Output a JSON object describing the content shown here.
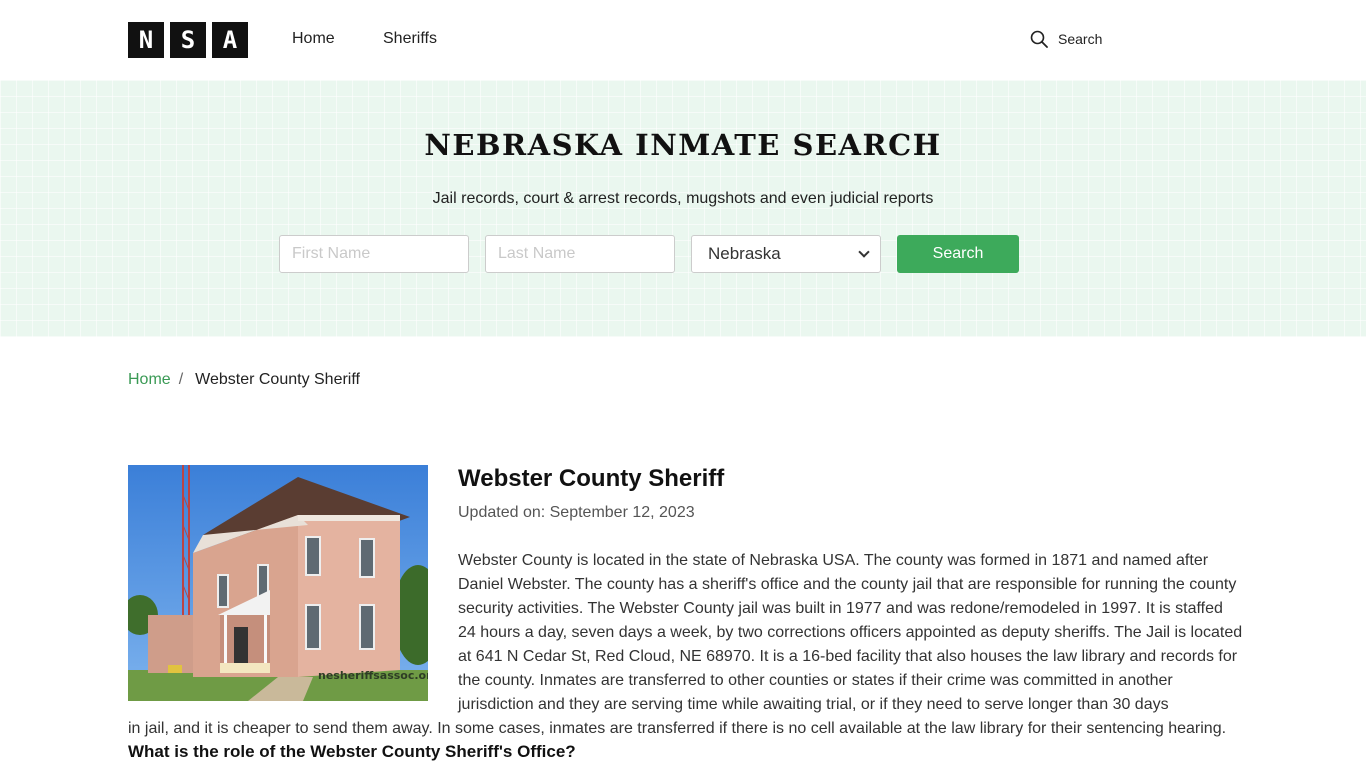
{
  "header": {
    "logo_letters": [
      "N",
      "S",
      "A"
    ],
    "nav": [
      {
        "label": "Home"
      },
      {
        "label": "Sheriffs"
      }
    ],
    "search_label": "Search"
  },
  "hero": {
    "title": "NEBRASKA INMATE SEARCH",
    "subtitle": "Jail records, court & arrest records, mugshots and even judicial reports",
    "first_name_placeholder": "First Name",
    "last_name_placeholder": "Last Name",
    "state_selected": "Nebraska",
    "search_button": "Search",
    "colors": {
      "background": "#eaf7ef",
      "button": "#3daa5b"
    }
  },
  "breadcrumb": {
    "home": "Home",
    "separator": "/",
    "current": "Webster County Sheriff"
  },
  "article": {
    "image_watermark": "nesheriffsassoc.org",
    "title": "Webster County Sheriff",
    "updated": "Updated on: September 12, 2023",
    "paragraph_top": "Webster County is located in the state of Nebraska USA. The county was formed in 1871 and named after Daniel Webster. The county has a sheriff's office and the county jail that are responsible for running the county security activities. The Webster County jail was built in 1977 and was redone/remodeled in 1997. It is staffed 24 hours a day, seven days a week, by two corrections officers appointed as deputy sheriffs.  The  Jail is located at 641 N Cedar St, Red Cloud, NE 68970. It is a 16-bed facility that also houses the law library and records for the county. Inmates are transferred to other counties or states if their crime was committed in another jurisdiction and they are serving time while awaiting trial, or if they need to serve longer than 30 days",
    "paragraph_bottom": "in jail, and it is cheaper to send them away. In some cases, inmates are transferred if there is no cell available at the law library for their sentencing hearing.",
    "question": "What is the role of the Webster County Sheriff's Office?"
  }
}
